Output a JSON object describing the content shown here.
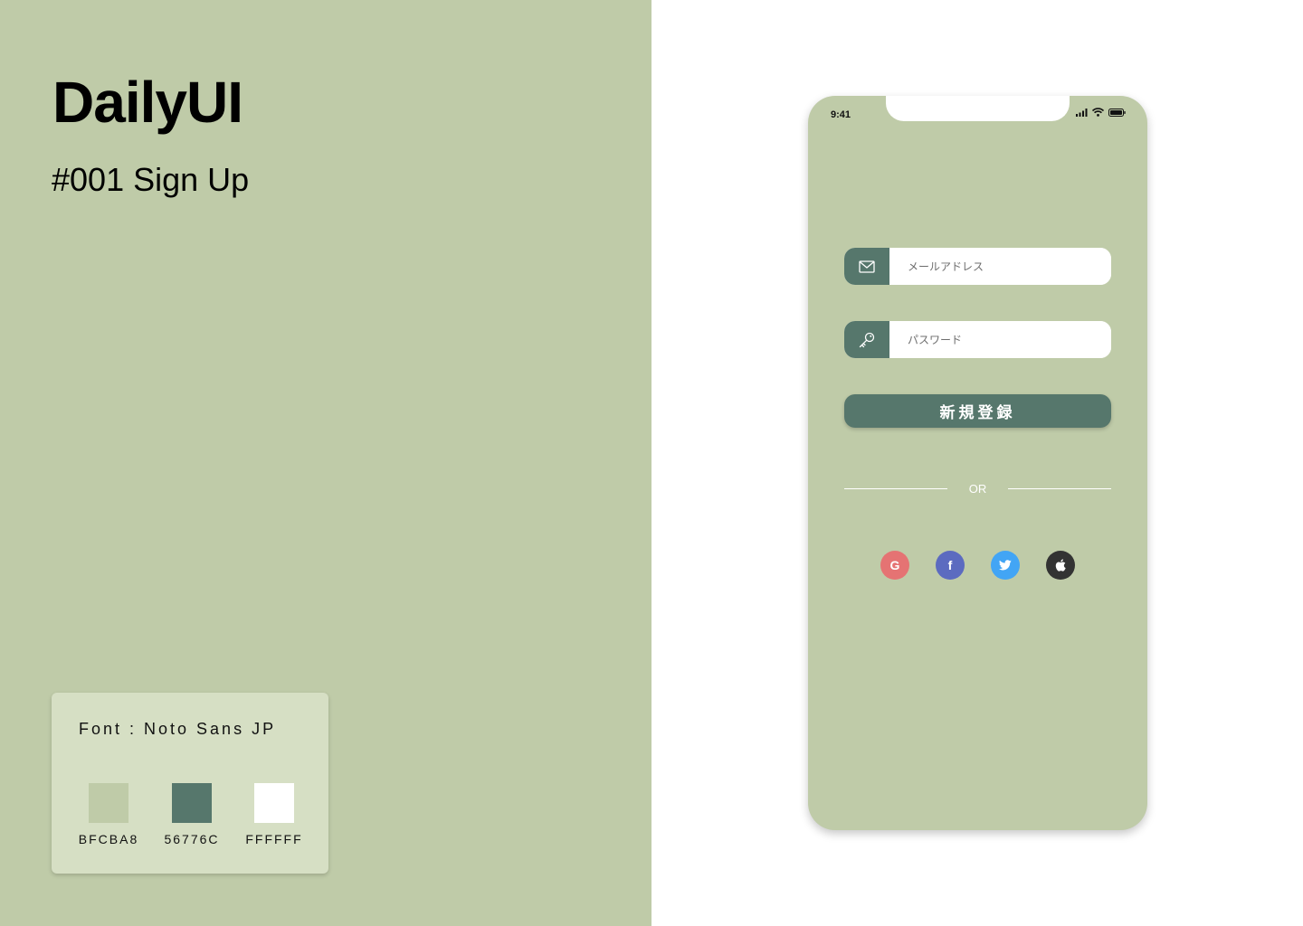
{
  "brand": {
    "title": "DailyUI",
    "subtitle": "#001 Sign Up"
  },
  "style_card": {
    "font_label": "Font : Noto Sans JP",
    "swatches": [
      {
        "hex": "#BFCBA8",
        "label": "BFCBA8"
      },
      {
        "hex": "#56776C",
        "label": "56776C"
      },
      {
        "hex": "#FFFFFF",
        "label": "FFFFFF"
      }
    ]
  },
  "phone": {
    "status_time": "9:41",
    "status_icons": [
      "signal-icon",
      "wifi-icon",
      "battery-icon"
    ],
    "email_field": {
      "icon": "mail-icon",
      "placeholder": "メールアドレス",
      "value": ""
    },
    "password_field": {
      "icon": "key-icon",
      "placeholder": "パスワード",
      "value": ""
    },
    "signup_button_label": "新規登録",
    "divider_text": "OR",
    "social": [
      {
        "icon": "google-icon",
        "glyph": "G",
        "color": "#E57373"
      },
      {
        "icon": "facebook-icon",
        "glyph": "f",
        "color": "#5C6BC0"
      },
      {
        "icon": "twitter-icon",
        "glyph": "",
        "color": "#42A5F5"
      },
      {
        "icon": "apple-icon",
        "glyph": "",
        "color": "#333333"
      }
    ]
  },
  "colors": {
    "background_green": "#BFCBA8",
    "accent_green": "#56776C",
    "white": "#FFFFFF",
    "card_green": "#D6DFC4"
  }
}
